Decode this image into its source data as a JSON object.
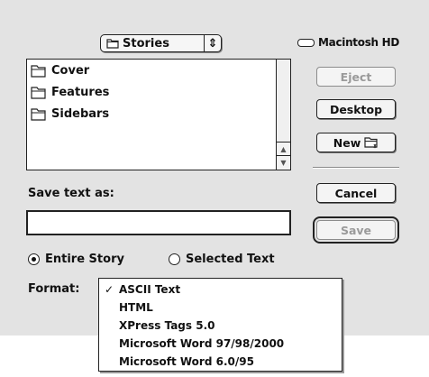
{
  "folder_popup": {
    "label": "Stories",
    "arrows": "⇕"
  },
  "disk": {
    "name": "Macintosh HD"
  },
  "file_list": {
    "items": [
      {
        "name": "Cover"
      },
      {
        "name": "Features"
      },
      {
        "name": "Sidebars"
      }
    ]
  },
  "buttons": {
    "eject": "Eject",
    "desktop": "Desktop",
    "new": "New",
    "cancel": "Cancel",
    "save": "Save"
  },
  "save_text_as": {
    "label": "Save text as:",
    "value": ""
  },
  "range": {
    "entire_story": "Entire Story",
    "selected_text": "Selected Text",
    "selected": "entire_story"
  },
  "format": {
    "label": "Format:",
    "options": [
      "ASCII Text",
      "HTML",
      "XPress Tags 5.0",
      "Microsoft Word 97/98/2000",
      "Microsoft Word 6.0/95"
    ],
    "selected": "ASCII Text",
    "check_mark": "✓"
  }
}
